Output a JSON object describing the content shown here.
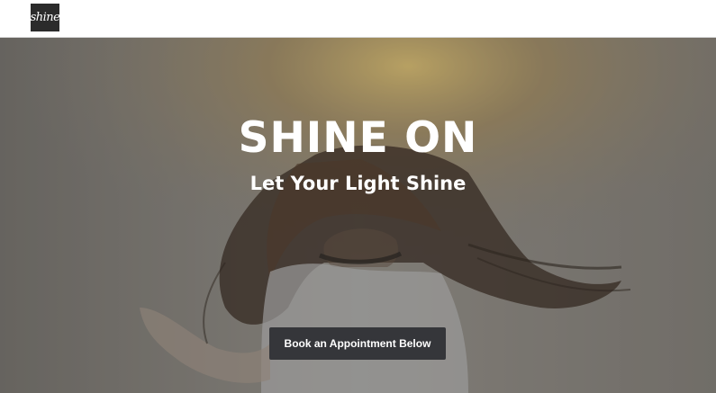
{
  "header": {
    "logo_text": "shine"
  },
  "hero": {
    "title": "SHINE ON",
    "subtitle": "Let Your Light Shine",
    "cta_label": "Book an Appointment Below"
  },
  "colors": {
    "header_bg": "#ffffff",
    "cta_bg": "#35363a",
    "hero_text": "#ffffff",
    "logo_bg": "#2b2b2b"
  }
}
